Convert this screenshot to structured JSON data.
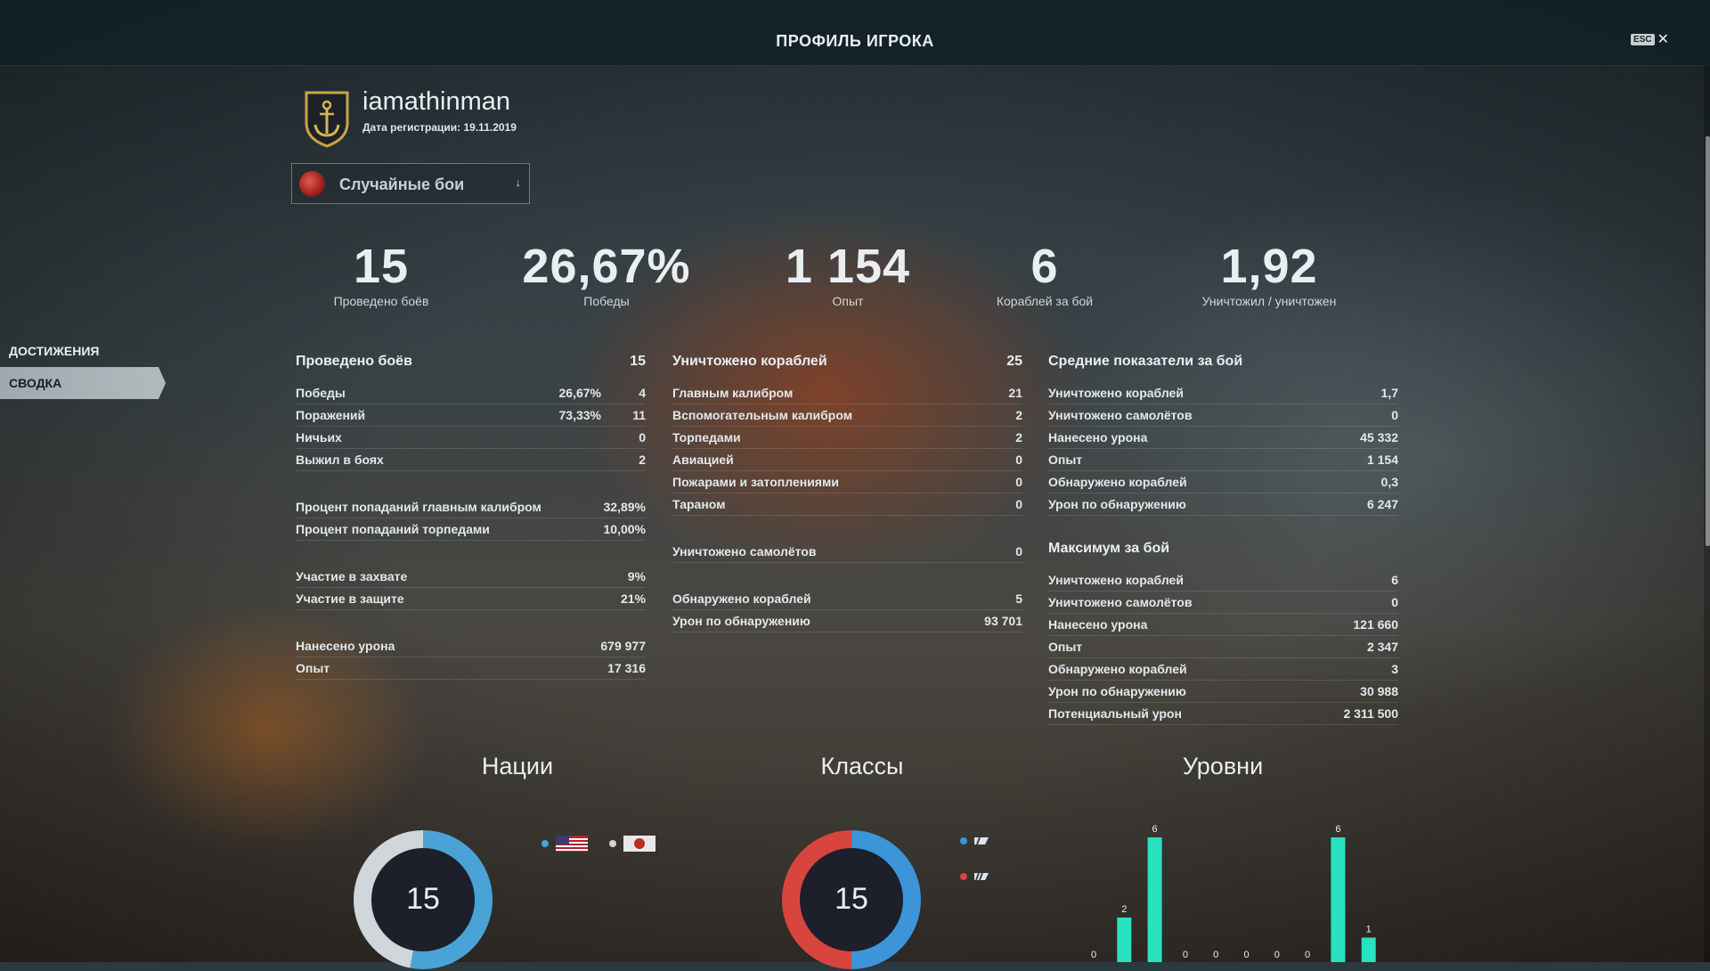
{
  "header": {
    "title": "ПРОФИЛЬ ИГРОКА",
    "esc_label": "ESC",
    "close_glyph": "✕"
  },
  "profile": {
    "username": "iamathinman",
    "reg_date": "Дата регистрации: 19.11.2019"
  },
  "mode_select": {
    "value": "Случайные бои",
    "chevron": "↓"
  },
  "kpis": [
    {
      "value": "15",
      "label": "Проведено боёв"
    },
    {
      "value": "26,67%",
      "label": "Победы"
    },
    {
      "value": "1 154",
      "label": "Опыт"
    },
    {
      "value": "6",
      "label": "Кораблей за бой"
    },
    {
      "value": "1,92",
      "label": "Уничтожил / уничтожен"
    }
  ],
  "sidenav": {
    "items": [
      {
        "label": "ДОСТИЖЕНИЯ"
      },
      {
        "label": "СВОДКА"
      }
    ]
  },
  "battles": {
    "title": "Проведено боёв",
    "value": "15",
    "rows": [
      {
        "label": "Победы",
        "pct": "26,67%",
        "value": "4"
      },
      {
        "label": "Поражений",
        "pct": "73,33%",
        "value": "11"
      },
      {
        "label": "Ничьих",
        "value": "0"
      },
      {
        "label": "Выжил в боях",
        "value": "2"
      }
    ],
    "rows2": [
      {
        "label": "Процент попаданий главным калибром",
        "value": "32,89%"
      },
      {
        "label": "Процент попаданий торпедами",
        "value": "10,00%"
      }
    ],
    "rows3": [
      {
        "label": "Участие в захвате",
        "value": "9%"
      },
      {
        "label": "Участие в защите",
        "value": "21%"
      }
    ],
    "rows4": [
      {
        "label": "Нанесено урона",
        "value": "679 977"
      },
      {
        "label": "Опыт",
        "value": "17 316"
      }
    ]
  },
  "destroyed": {
    "title": "Уничтожено кораблей",
    "value": "25",
    "rows": [
      {
        "label": "Главным калибром",
        "value": "21"
      },
      {
        "label": "Вспомогательным калибром",
        "value": "2"
      },
      {
        "label": "Торпедами",
        "value": "2"
      },
      {
        "label": "Авиацией",
        "value": "0"
      },
      {
        "label": "Пожарами и затоплениями",
        "value": "0"
      },
      {
        "label": "Тараном",
        "value": "0"
      }
    ],
    "rows2": [
      {
        "label": "Уничтожено самолётов",
        "value": "0"
      }
    ],
    "rows3": [
      {
        "label": "Обнаружено кораблей",
        "value": "5"
      },
      {
        "label": "Урон по обнаружению",
        "value": "93 701"
      }
    ]
  },
  "averages": {
    "title": "Средние показатели за бой",
    "rows": [
      {
        "label": "Уничтожено кораблей",
        "value": "1,7"
      },
      {
        "label": "Уничтожено самолётов",
        "value": "0"
      },
      {
        "label": "Нанесено урона",
        "value": "45 332"
      },
      {
        "label": "Опыт",
        "value": "1 154"
      },
      {
        "label": "Обнаружено кораблей",
        "value": "0,3"
      },
      {
        "label": "Урон по обнаружению",
        "value": "6 247"
      }
    ]
  },
  "maximum": {
    "title": "Максимум за бой",
    "rows": [
      {
        "label": "Уничтожено кораблей",
        "value": "6"
      },
      {
        "label": "Уничтожено самолётов",
        "value": "0"
      },
      {
        "label": "Нанесено урона",
        "value": "121 660"
      },
      {
        "label": "Опыт",
        "value": "2 347"
      },
      {
        "label": "Обнаружено кораблей",
        "value": "3"
      },
      {
        "label": "Урон по обнаружению",
        "value": "30 988"
      },
      {
        "label": "Потенциальный урон",
        "value": "2 311 500"
      }
    ]
  },
  "nations": {
    "title": "Нации",
    "total": "15",
    "segments": [
      {
        "fraction": 0.53,
        "color": "#4aa3d6"
      },
      {
        "fraction": 0.47,
        "color": "#d0d6d9"
      }
    ],
    "legend": [
      {
        "icon": "us-flag-icon",
        "dot_color": "#4aa3d6"
      },
      {
        "icon": "japan-flag-icon",
        "dot_color": "#d0d6d9"
      }
    ]
  },
  "classes": {
    "title": "Классы",
    "total": "15",
    "segments": [
      {
        "fraction": 0.5,
        "color": "#3c95d8"
      },
      {
        "fraction": 0.5,
        "color": "#d8453e"
      }
    ],
    "legend": [
      {
        "icon": "destroyer-class-icon",
        "dot_color": "#3c95d8"
      },
      {
        "icon": "cruiser-class-icon",
        "dot_color": "#d8453e"
      }
    ]
  },
  "tiers": {
    "title": "Уровни",
    "values": [
      0,
      2,
      6,
      0,
      0,
      0,
      0,
      0,
      6,
      1
    ],
    "bar_color": "#27e3c0"
  }
}
